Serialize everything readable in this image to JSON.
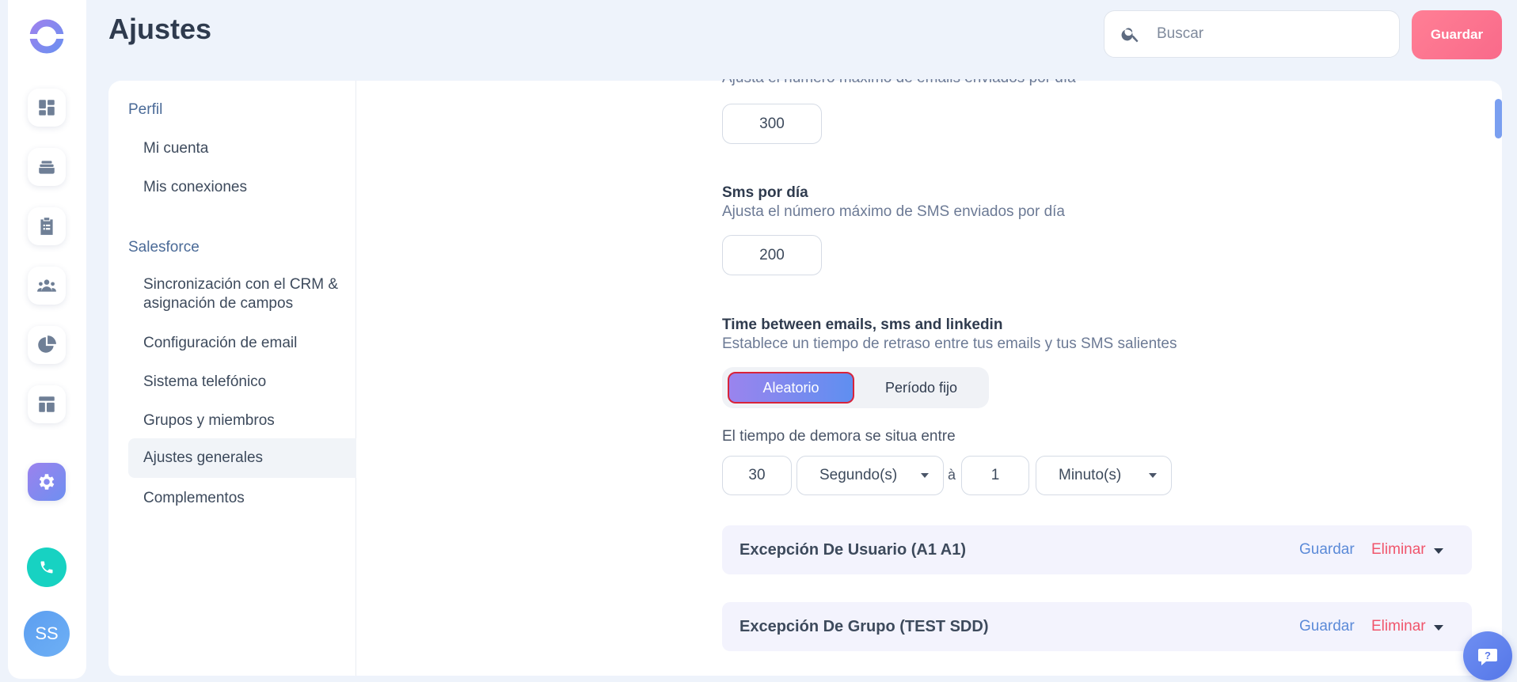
{
  "header": {
    "title": "Ajustes",
    "search_placeholder": "Buscar",
    "save_label": "Guardar"
  },
  "rail": {
    "items": [
      {
        "icon": "dashboard-icon"
      },
      {
        "icon": "inbox-icon"
      },
      {
        "icon": "clipboard-icon"
      },
      {
        "icon": "team-icon"
      },
      {
        "icon": "pie-chart-icon"
      },
      {
        "icon": "layout-icon"
      },
      {
        "icon": "gear-icon",
        "active": true
      }
    ],
    "avatar_initials": "SS"
  },
  "nav": {
    "sections": [
      {
        "label": "Perfil",
        "items": [
          "Mi cuenta",
          "Mis conexiones"
        ]
      },
      {
        "label": "Salesforce",
        "items": [
          "Sincronización con el CRM & asignación de campos",
          "Configuración de email",
          "Sistema telefónico",
          "Grupos y miembros",
          "Ajustes generales",
          "Complementos"
        ]
      }
    ],
    "active_item": "Ajustes generales"
  },
  "content": {
    "emails_cut_desc": "Ajusta el número máximo de emails enviados por día",
    "emails_value": "300",
    "sms_title": "Sms por día",
    "sms_desc": "Ajusta el número máximo de SMS enviados por día",
    "sms_value": "200",
    "time_title": "Time between emails, sms and linkedin",
    "time_desc": "Establece un tiempo de retraso entre tus emails y tus SMS salientes",
    "toggle": {
      "selected": "Aleatorio",
      "other": "Período fijo"
    },
    "delay_label": "El tiempo de demora se situa entre",
    "delay_from_value": "30",
    "delay_from_unit": "Segundo(s)",
    "delay_sep": "à",
    "delay_to_value": "1",
    "delay_to_unit": "Minuto(s)",
    "exceptions": [
      {
        "title": "Excepción De Usuario (A1 A1)",
        "save": "Guardar",
        "delete": "Eliminar"
      },
      {
        "title": "Excepción De Grupo (TEST SDD)",
        "save": "Guardar",
        "delete": "Eliminar"
      }
    ]
  },
  "colors": {
    "accent": "#7a8ff0",
    "save_button": "#f9708e",
    "delete": "#f0556c",
    "phone": "#17d2c2"
  }
}
